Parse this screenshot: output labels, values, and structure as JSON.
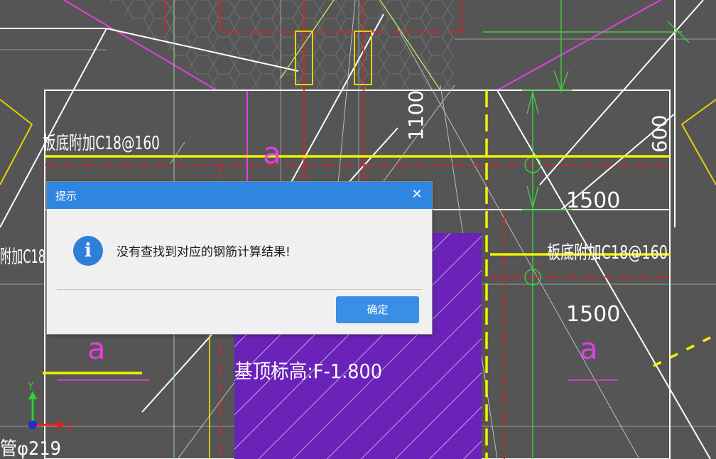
{
  "cad": {
    "labels": {
      "rebar_top_left": "板底附加C18@160",
      "rebar_left_cut": "附加C18",
      "rebar_right": "板底附加C18@160",
      "dim_1100": "1100",
      "dim_600": "600",
      "dim_1500_a": "1500",
      "dim_1500_b": "1500",
      "section_mark_a": "a",
      "section_mark_b": "a",
      "section_mark_c": "a",
      "elevation": "基顶标高:F-1.800",
      "pipe": "管φ219"
    },
    "axis": {
      "x": "X",
      "y": "Y"
    }
  },
  "dialog": {
    "title": "提示",
    "close_glyph": "✕",
    "icon_glyph": "i",
    "message": "没有查找到对应的钢筋计算结果!",
    "ok_label": "确定"
  },
  "colors": {
    "canvas": "#555555",
    "titlebar": "#2f86e0",
    "button": "#3a8ee6",
    "rebar_yellow": "#f2f200",
    "fill_purple": "#6a22b8"
  }
}
